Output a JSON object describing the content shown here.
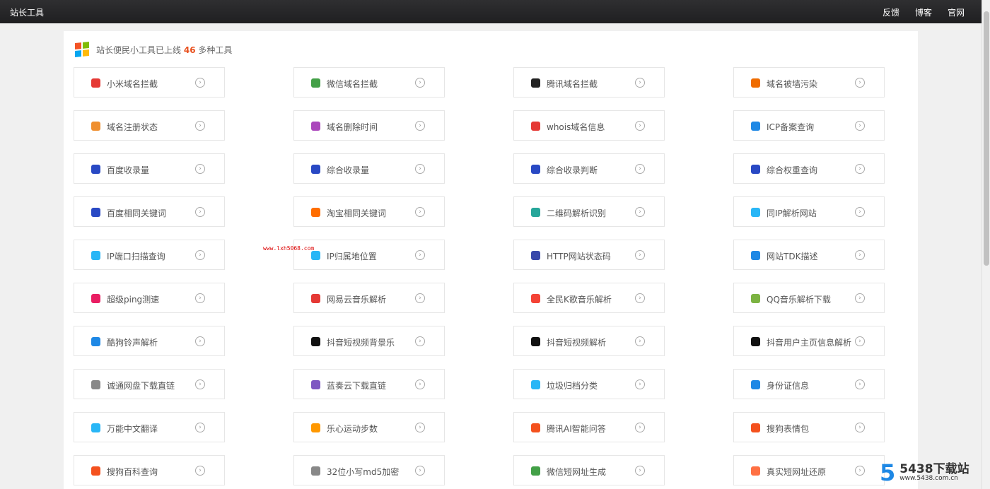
{
  "topbar": {
    "brand": "站长工具",
    "nav": [
      "反馈",
      "博客",
      "官网"
    ]
  },
  "headline": {
    "prefix": "站长便民小工具已上线",
    "count": "46",
    "suffix": "多种工具"
  },
  "tools": [
    {
      "label": "小米域名拦截",
      "icon": "mi-icon",
      "color": "#e53935"
    },
    {
      "label": "微信域名拦截",
      "icon": "wechat-icon",
      "color": "#43a047"
    },
    {
      "label": "腾讯域名拦截",
      "icon": "qq-penguin-icon",
      "color": "#222222"
    },
    {
      "label": "域名被墙污染",
      "icon": "wall-icon",
      "color": "#ef6c00"
    },
    {
      "label": "域名注册状态",
      "icon": "www-icon",
      "color": "#ef8f2f"
    },
    {
      "label": "域名删除时间",
      "icon": "trash-icon",
      "color": "#ab47bc"
    },
    {
      "label": "whois域名信息",
      "icon": "globe-icon",
      "color": "#e53935"
    },
    {
      "label": "ICP备案查询",
      "icon": "shield-icon",
      "color": "#1e88e5"
    },
    {
      "label": "百度收录量",
      "icon": "baidu-paw-icon",
      "color": "#2949c4"
    },
    {
      "label": "综合收录量",
      "icon": "baidu-paw-icon",
      "color": "#2949c4"
    },
    {
      "label": "综合收录判断",
      "icon": "baidu-paw-icon",
      "color": "#2949c4"
    },
    {
      "label": "综合权重查询",
      "icon": "baidu-paw-icon",
      "color": "#2949c4"
    },
    {
      "label": "百度相同关键词",
      "icon": "baidu-paw-icon",
      "color": "#2949c4"
    },
    {
      "label": "淘宝相同关键词",
      "icon": "taobao-icon",
      "color": "#ff6d00"
    },
    {
      "label": "二维码解析识别",
      "icon": "qrcode-icon",
      "color": "#26a69a"
    },
    {
      "label": "同IP解析网站",
      "icon": "location-pin-icon",
      "color": "#29b6f6"
    },
    {
      "label": "IP端口扫描查询",
      "icon": "location-pin-icon",
      "color": "#29b6f6"
    },
    {
      "label": "IP归属地位置",
      "icon": "location-pin-icon",
      "color": "#29b6f6"
    },
    {
      "label": "HTTP网站状态码",
      "icon": "pulse-icon",
      "color": "#3949ab"
    },
    {
      "label": "网站TDK描述",
      "icon": "document-icon",
      "color": "#1e88e5"
    },
    {
      "label": "超级ping测速",
      "icon": "speedometer-icon",
      "color": "#e91e63"
    },
    {
      "label": "网易云音乐解析",
      "icon": "netease-music-icon",
      "color": "#e53935"
    },
    {
      "label": "全民K歌音乐解析",
      "icon": "karaoke-icon",
      "color": "#f44336"
    },
    {
      "label": "QQ音乐解析下载",
      "icon": "music-note-icon",
      "color": "#7cb342"
    },
    {
      "label": "酷狗铃声解析",
      "icon": "kugou-icon",
      "color": "#1e88e5"
    },
    {
      "label": "抖音短视频背景乐",
      "icon": "tiktok-icon",
      "color": "#111111"
    },
    {
      "label": "抖音短视频解析",
      "icon": "tiktok-icon",
      "color": "#111111"
    },
    {
      "label": "抖音用户主页信息解析",
      "icon": "tiktok-icon",
      "color": "#111111"
    },
    {
      "label": "诚通网盘下载直链",
      "icon": "cloud-icon",
      "color": "#888888"
    },
    {
      "label": "蓝奏云下载直链",
      "icon": "cloud-icon",
      "color": "#7e57c2"
    },
    {
      "label": "垃圾归档分类",
      "icon": "bin-icon",
      "color": "#29b6f6"
    },
    {
      "label": "身份证信息",
      "icon": "id-card-icon",
      "color": "#1e88e5"
    },
    {
      "label": "万能中文翻译",
      "icon": "translate-icon",
      "color": "#29b6f6"
    },
    {
      "label": "乐心运动步数",
      "icon": "shoe-icon",
      "color": "#ff9800"
    },
    {
      "label": "腾讯AI智能问答",
      "icon": "ai-chat-icon",
      "color": "#f4511e"
    },
    {
      "label": "搜狗表情包",
      "icon": "sogou-icon",
      "color": "#f4511e"
    },
    {
      "label": "搜狗百科查询",
      "icon": "sogou-icon",
      "color": "#f4511e"
    },
    {
      "label": "32位小写md5加密",
      "icon": "lock-icon",
      "color": "#888888"
    },
    {
      "label": "微信短网址生成",
      "icon": "wechat-icon",
      "color": "#43a047"
    },
    {
      "label": "真实短网址还原",
      "icon": "link-box-icon",
      "color": "#ff7043"
    }
  ],
  "watermark_mid": "www.lxh5068.com",
  "watermark": {
    "digit": "5",
    "title": "5438下载站",
    "url": "www.5438.com.cn"
  }
}
